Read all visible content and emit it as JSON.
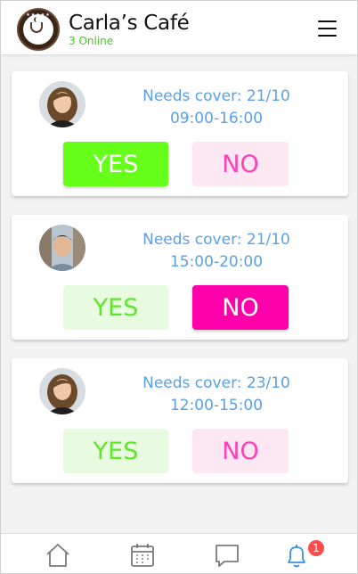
{
  "header": {
    "title": "Carla’s Café",
    "online_status": "3 Online",
    "logo_icon": "cafe-logo-icon",
    "menu_icon": "hamburger-menu-icon"
  },
  "requests": [
    {
      "label": "Needs cover: 21/10",
      "time": "09:00-16:00",
      "yes_label": "YES",
      "no_label": "NO",
      "response": "yes",
      "avatar": "woman-avatar"
    },
    {
      "label": "Needs cover: 21/10",
      "time": "15:00-20:00",
      "yes_label": "YES",
      "no_label": "NO",
      "response": "no",
      "avatar": "man-avatar"
    },
    {
      "label": "Needs cover: 23/10",
      "time": "12:00-15:00",
      "yes_label": "YES",
      "no_label": "NO",
      "response": "none",
      "avatar": "woman-avatar"
    }
  ],
  "bottom_nav": {
    "items": [
      {
        "icon": "home-icon"
      },
      {
        "icon": "calendar-icon"
      },
      {
        "icon": "chat-icon"
      },
      {
        "icon": "bell-icon",
        "badge": "1"
      }
    ]
  },
  "colors": {
    "yes_active": "#66ff1a",
    "no_active": "#ff00aa",
    "accent_text": "#5aa0e6",
    "online_green": "#3fcf1a",
    "nav_bell": "#3b8fe6",
    "badge_red": "#ff4d4d"
  }
}
